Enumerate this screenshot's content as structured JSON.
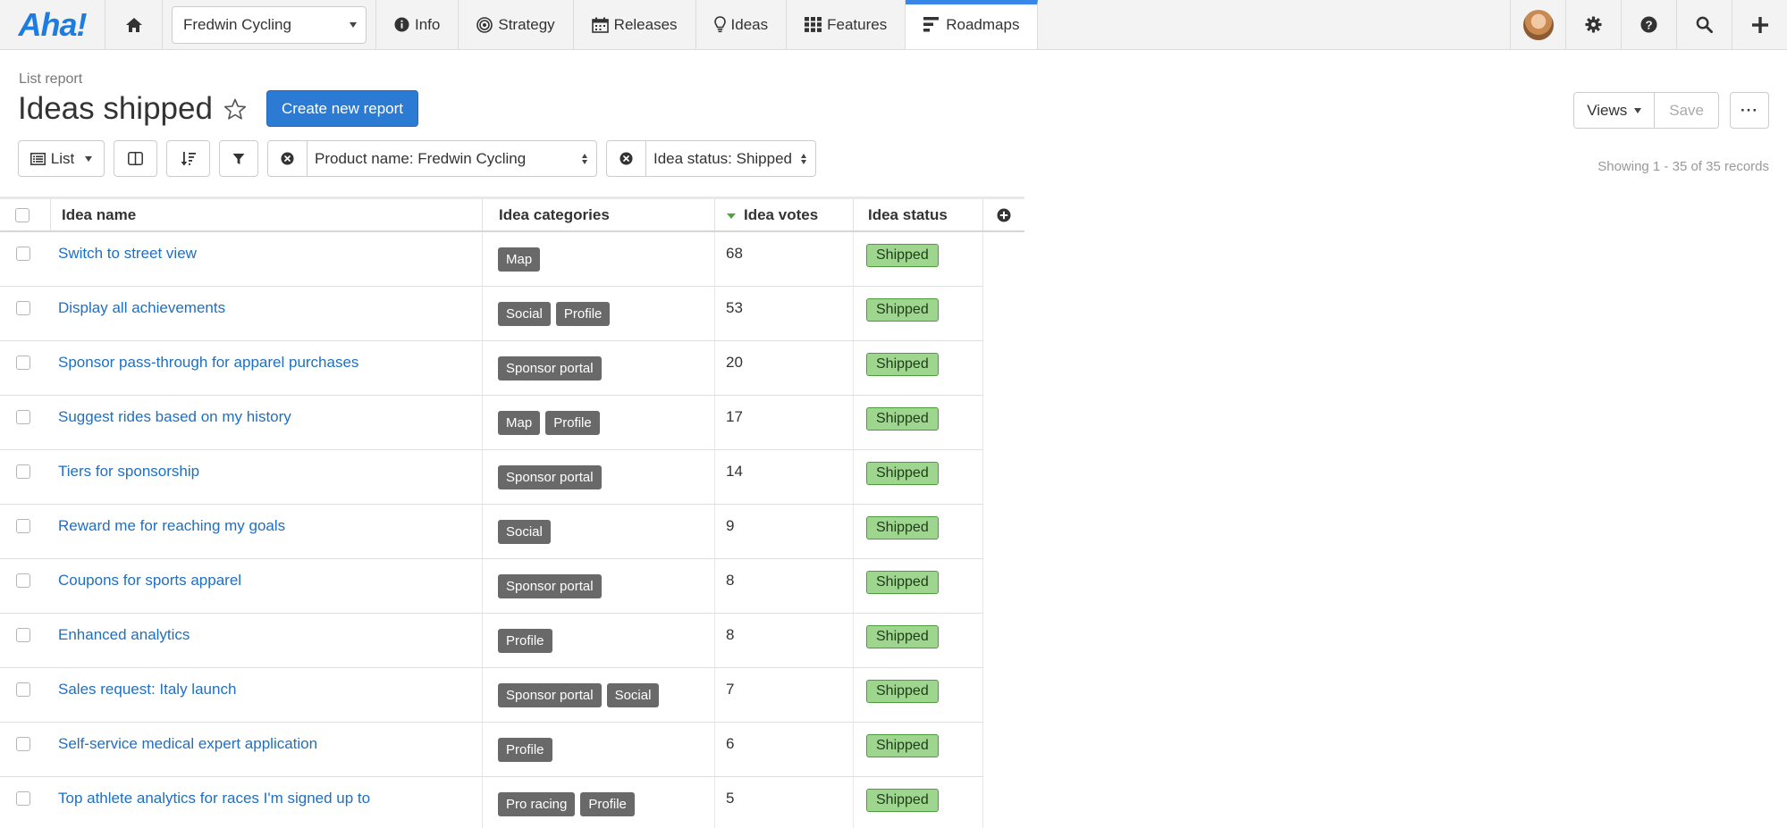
{
  "nav": {
    "logo": "Aha!",
    "workspace": "Fredwin Cycling",
    "tabs": [
      {
        "label": "Info",
        "icon": "info-icon"
      },
      {
        "label": "Strategy",
        "icon": "target-icon"
      },
      {
        "label": "Releases",
        "icon": "calendar-icon"
      },
      {
        "label": "Ideas",
        "icon": "lightbulb-icon"
      },
      {
        "label": "Features",
        "icon": "grid-icon"
      },
      {
        "label": "Roadmaps",
        "icon": "roadmap-icon",
        "active": true
      }
    ],
    "right_icons": [
      "avatar",
      "gear-icon",
      "help-icon",
      "search-icon",
      "plus-icon"
    ]
  },
  "header": {
    "report_type": "List report",
    "title": "Ideas shipped",
    "create_button": "Create new report",
    "views_button": "Views",
    "save_button": "Save",
    "more_button": "···"
  },
  "toolbar": {
    "view_button": "List",
    "filters": [
      {
        "label": "Product name: Fredwin Cycling"
      },
      {
        "label": "Idea status: Shipped"
      }
    ],
    "showing": "Showing 1 - 35 of 35 records"
  },
  "table": {
    "columns": [
      "Idea name",
      "Idea categories",
      "Idea votes",
      "Idea status"
    ],
    "sorted_column": "Idea votes",
    "rows": [
      {
        "name": "Switch to street view",
        "categories": [
          "Map"
        ],
        "votes": "68",
        "status": "Shipped"
      },
      {
        "name": "Display all achievements",
        "categories": [
          "Social",
          "Profile"
        ],
        "votes": "53",
        "status": "Shipped"
      },
      {
        "name": "Sponsor pass-through for apparel purchases",
        "categories": [
          "Sponsor portal"
        ],
        "votes": "20",
        "status": "Shipped"
      },
      {
        "name": "Suggest rides based on my history",
        "categories": [
          "Map",
          "Profile"
        ],
        "votes": "17",
        "status": "Shipped"
      },
      {
        "name": "Tiers for sponsorship",
        "categories": [
          "Sponsor portal"
        ],
        "votes": "14",
        "status": "Shipped"
      },
      {
        "name": "Reward me for reaching my goals",
        "categories": [
          "Social"
        ],
        "votes": "9",
        "status": "Shipped"
      },
      {
        "name": "Coupons for sports apparel",
        "categories": [
          "Sponsor portal"
        ],
        "votes": "8",
        "status": "Shipped"
      },
      {
        "name": "Enhanced analytics",
        "categories": [
          "Profile"
        ],
        "votes": "8",
        "status": "Shipped"
      },
      {
        "name": "Sales request: Italy launch",
        "categories": [
          "Sponsor portal",
          "Social"
        ],
        "votes": "7",
        "status": "Shipped"
      },
      {
        "name": "Self-service medical expert application",
        "categories": [
          "Profile"
        ],
        "votes": "6",
        "status": "Shipped"
      },
      {
        "name": "Top athlete analytics for races I'm signed up to",
        "categories": [
          "Pro racing",
          "Profile"
        ],
        "votes": "5",
        "status": "Shipped"
      }
    ]
  },
  "colors": {
    "brand": "#1c7ce0",
    "primary_button": "#2b7bd4",
    "link": "#1f6fc2",
    "tag": "#696969",
    "status_shipped": "#9fd68f",
    "active_tab": "#3a86e8"
  }
}
